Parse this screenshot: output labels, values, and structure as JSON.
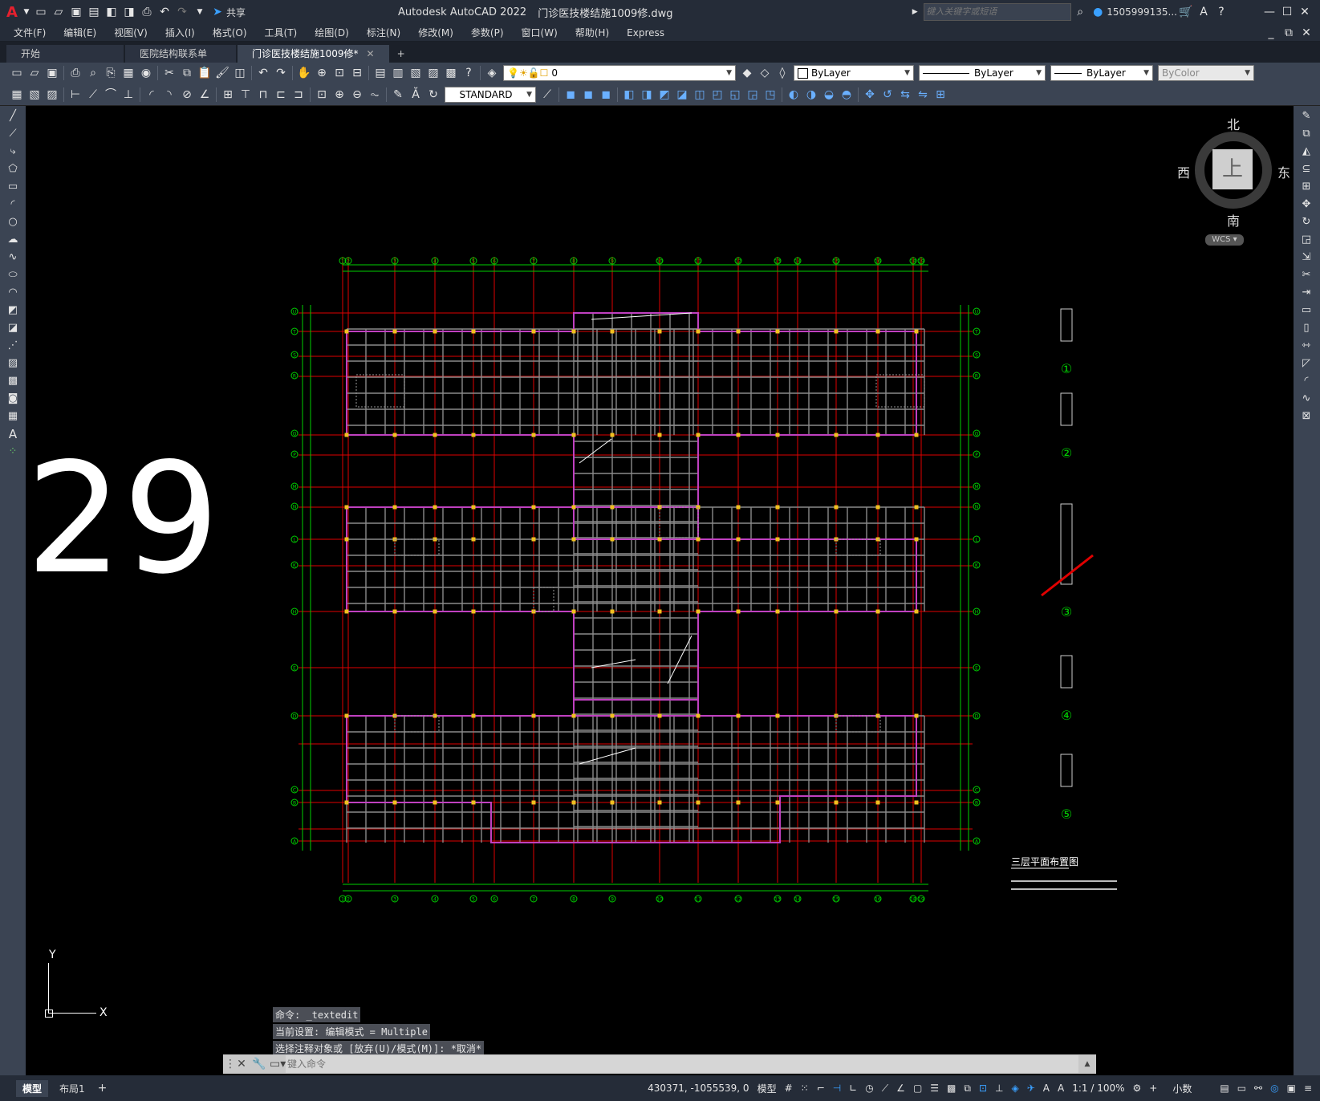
{
  "app": {
    "title": "Autodesk AutoCAD 2022",
    "filename": "门诊医技楼结施1009修.dwg",
    "share_label": "共享",
    "search_placeholder": "键入关键字或短语",
    "user": "1505999135...",
    "logo": "A"
  },
  "menu": [
    "文件(F)",
    "编辑(E)",
    "视图(V)",
    "插入(I)",
    "格式(O)",
    "工具(T)",
    "绘图(D)",
    "标注(N)",
    "修改(M)",
    "参数(P)",
    "窗口(W)",
    "帮助(H)",
    "Express"
  ],
  "tabs": [
    {
      "label": "开始",
      "active": false
    },
    {
      "label": "医院结构联系单",
      "active": false
    },
    {
      "label": "门诊医技楼结施1009修*",
      "active": true
    }
  ],
  "toolbar": {
    "layer_value": "0",
    "color_value": "ByLayer",
    "linetype_value": "ByLayer",
    "lineweight_value": "ByLayer",
    "plotstyle_value": "ByColor",
    "textstyle_value": "STANDARD"
  },
  "viewcube": {
    "north": "北",
    "south": "南",
    "east": "东",
    "west": "西",
    "top": "上",
    "wcs": "WCS"
  },
  "overlay_number": "29",
  "drawing": {
    "title": "三层平面布置图",
    "details": [
      "①",
      "②",
      "③",
      "④",
      "⑤"
    ],
    "grid_rows": [
      "U",
      "T",
      "S",
      "R",
      "Q",
      "P",
      "M",
      "N",
      "L",
      "K",
      "H",
      "E",
      "D",
      "C",
      "B",
      "A"
    ],
    "grid_cols": [
      "1",
      "2",
      "3",
      "4",
      "5",
      "6",
      "7",
      "8",
      "9",
      "10",
      "11",
      "12",
      "13",
      "14",
      "15",
      "16",
      "18",
      "19"
    ]
  },
  "command": {
    "history": [
      "命令: _textedit",
      "当前设置: 编辑模式 = Multiple",
      "选择注释对象或 [放弃(U)/模式(M)]: *取消*"
    ],
    "placeholder": "键入命令"
  },
  "status": {
    "layout_tabs": [
      "模型",
      "布局1"
    ],
    "coords": "430371, -1055539, 0",
    "model": "模型",
    "scale": "1:1 / 100%",
    "units": "小数"
  },
  "colors": {
    "grid": "#e00000",
    "axis": "#00d000",
    "wall": "#c040c0",
    "beam": "#8a8a8a",
    "column": "#f0c020",
    "bg": "#000000"
  }
}
